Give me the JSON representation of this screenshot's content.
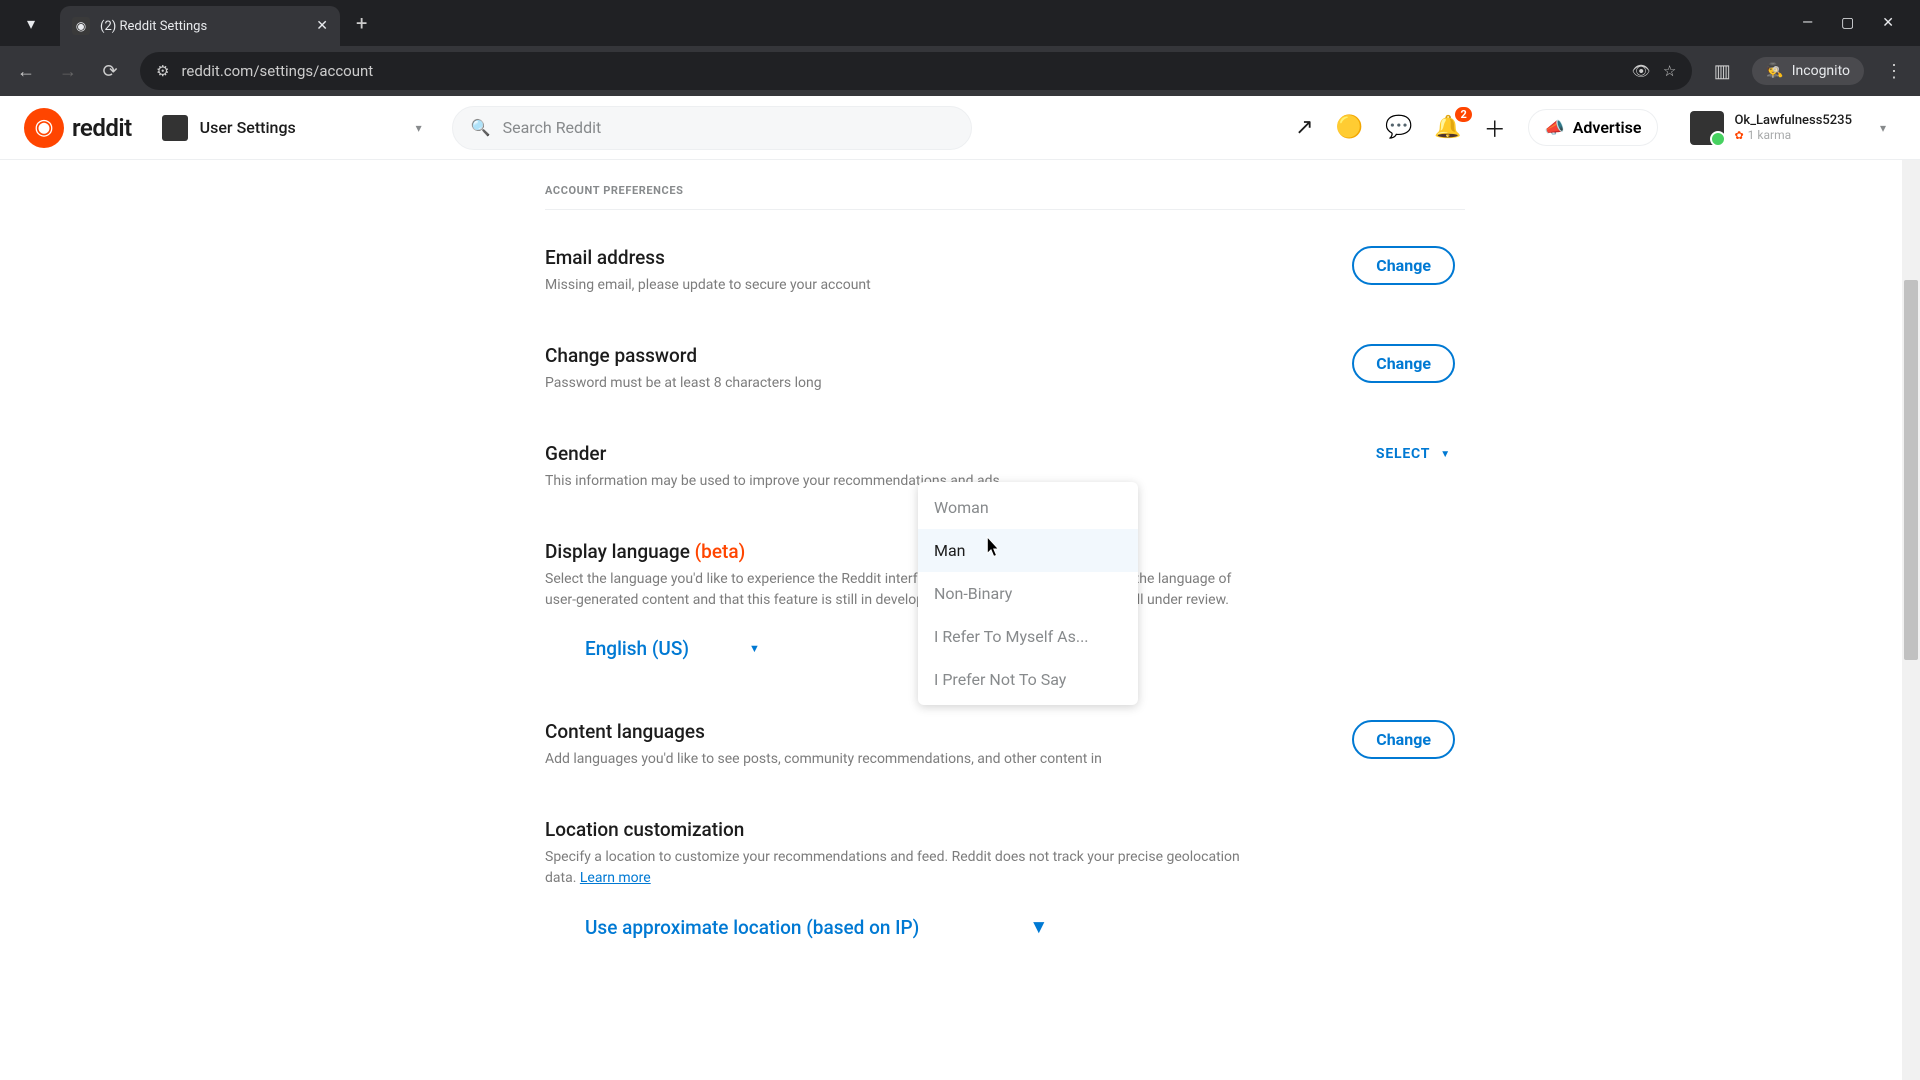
{
  "browser": {
    "tab_title": "(2) Reddit Settings",
    "url": "reddit.com/settings/account",
    "incognito_label": "Incognito"
  },
  "header": {
    "brand": "reddit",
    "nav_label": "User Settings",
    "search_placeholder": "Search Reddit",
    "advertise_label": "Advertise",
    "notif_count": "2",
    "user": {
      "name": "Ok_Lawfulness5235",
      "karma": "1 karma"
    }
  },
  "settings": {
    "section_label": "ACCOUNT PREFERENCES",
    "email": {
      "title": "Email address",
      "desc": "Missing email, please update to secure your account",
      "btn": "Change"
    },
    "password": {
      "title": "Change password",
      "desc": "Password must be at least 8 characters long",
      "btn": "Change"
    },
    "gender": {
      "title": "Gender",
      "desc": "This information may be used to improve your recommendations and ads.",
      "select_label": "SELECT",
      "options": [
        "Woman",
        "Man",
        "Non-Binary",
        "I Refer To Myself As...",
        "I Prefer Not To Say"
      ]
    },
    "display_lang": {
      "title": "Display language",
      "beta": "(beta)",
      "desc": "Select the language you'd like to experience the Reddit interface in. Note that this won't change the language of user-generated content and that this feature is still in development so translations and UI are still under review.",
      "value": "English (US)"
    },
    "content_lang": {
      "title": "Content languages",
      "desc": "Add languages you'd like to see posts, community recommendations, and other content in",
      "btn": "Change"
    },
    "location": {
      "title": "Location customization",
      "desc": "Specify a location to customize your recommendations and feed. Reddit does not track your precise geolocation data. ",
      "learn": "Learn more",
      "value": "Use approximate location (based on IP)"
    }
  }
}
